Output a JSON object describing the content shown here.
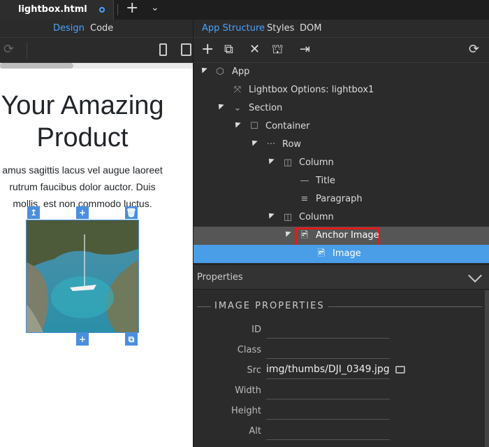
{
  "tab": {
    "title": "lightbox.html"
  },
  "left_panel": {
    "view_tabs": {
      "design": "Design",
      "code": "Code"
    },
    "hero": {
      "title_line1": "Your Amazing",
      "title_line2": "Product",
      "text_line1": "amus sagittis lacus vel augue laoreet",
      "text_line2": "rutrum faucibus dolor auctor. Duis",
      "text_line3": "mollis, est non commodo luctus."
    }
  },
  "right_panel": {
    "tabs": {
      "app_structure": "App Structure",
      "styles": "Styles",
      "dom": "DOM"
    },
    "tree": [
      {
        "label": "App",
        "icon": "cube-icon"
      },
      {
        "label": "Lightbox Options: lightbox1",
        "icon": "expand-icon"
      },
      {
        "label": "Section",
        "icon": "chevrons-down-icon"
      },
      {
        "label": "Container",
        "icon": "square-icon"
      },
      {
        "label": "Row",
        "icon": "dots-icon"
      },
      {
        "label": "Column",
        "icon": "column-icon"
      },
      {
        "label": "Title",
        "icon": "title-line-icon"
      },
      {
        "label": "Paragraph",
        "icon": "paragraph-lines-icon"
      },
      {
        "label": "Column",
        "icon": "column-icon"
      },
      {
        "label": "Anchor Image",
        "icon": "image-file-icon"
      },
      {
        "label": "Image",
        "icon": "image-file-icon"
      }
    ],
    "properties": {
      "header": "Properties",
      "section_title": "IMAGE PROPERTIES",
      "rows": [
        {
          "label": "ID",
          "value": ""
        },
        {
          "label": "Class",
          "value": ""
        },
        {
          "label": "Src",
          "value": "img/thumbs/DJI_0349.jpg"
        },
        {
          "label": "Width",
          "value": ""
        },
        {
          "label": "Height",
          "value": ""
        },
        {
          "label": "Alt",
          "value": ""
        }
      ]
    }
  },
  "colors": {
    "accent": "#4aa3ff",
    "selection": "#4a9ee8",
    "highlight_box": "#e01b1b"
  }
}
